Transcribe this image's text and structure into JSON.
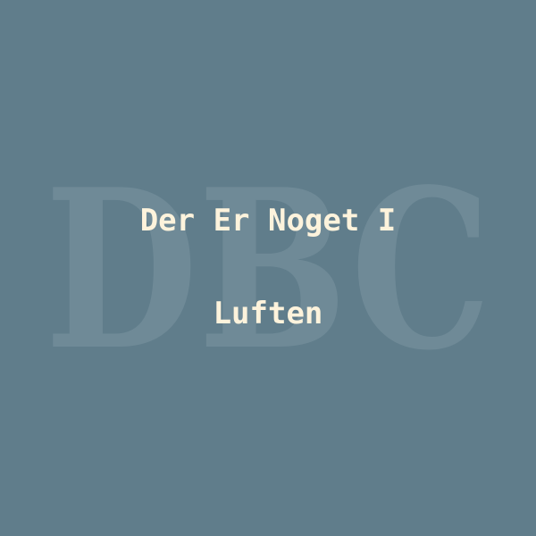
{
  "cover": {
    "background_color": "#607d8b",
    "watermark": {
      "text": "DBC",
      "color": "#6f8a97"
    },
    "title": {
      "lines": [
        "Der Er Noget I",
        "Luften"
      ],
      "color": "#fdf3dc"
    }
  }
}
